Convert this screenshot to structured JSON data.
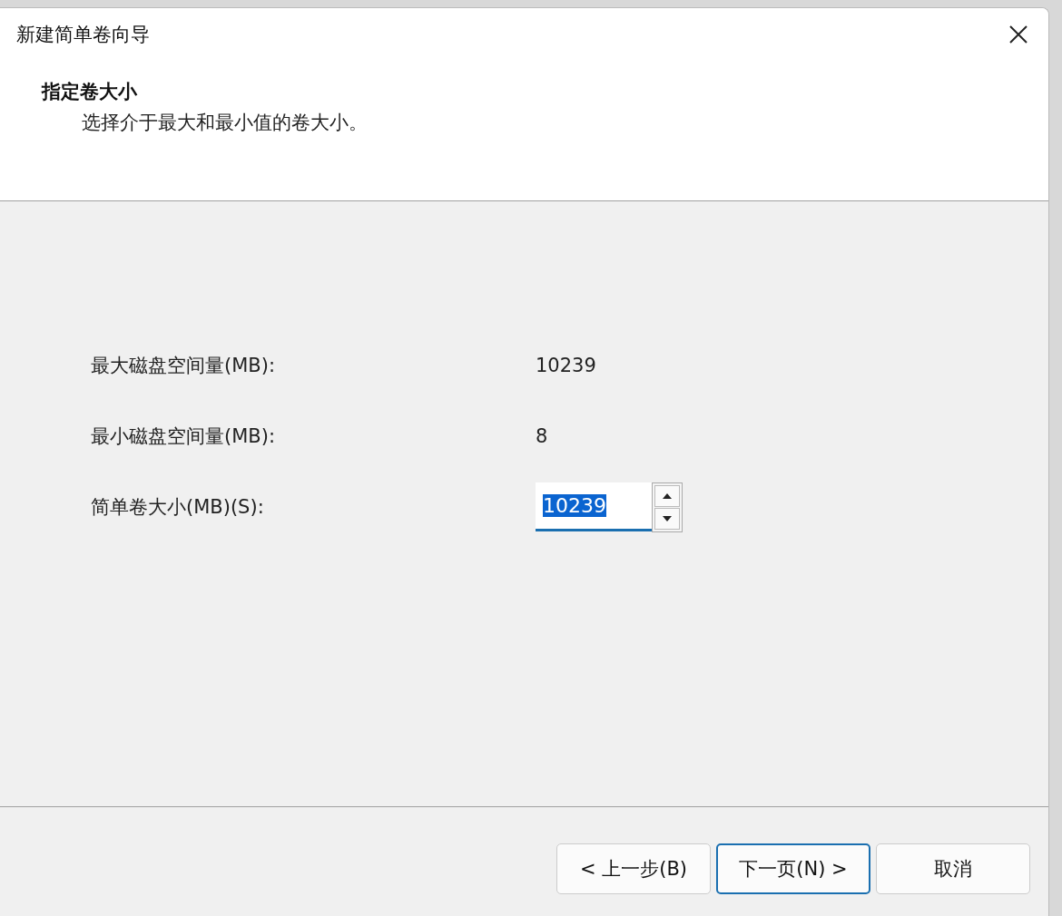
{
  "window": {
    "title": "新建简单卷向导"
  },
  "header": {
    "title": "指定卷大小",
    "subtitle": "选择介于最大和最小值的卷大小。"
  },
  "fields": [
    {
      "kind": "readout",
      "label": "最大磁盘空间量(MB):",
      "value": "10239"
    },
    {
      "kind": "readout",
      "label": "最小磁盘空间量(MB):",
      "value": "8"
    },
    {
      "kind": "spinner",
      "label": "简单卷大小(MB)(S):",
      "value": "10239",
      "text_selected": true
    }
  ],
  "buttons": [
    {
      "label": "< 上一步(B)",
      "default": false
    },
    {
      "label": "下一页(N) >",
      "default": true
    },
    {
      "label": "取消",
      "default": false
    }
  ]
}
